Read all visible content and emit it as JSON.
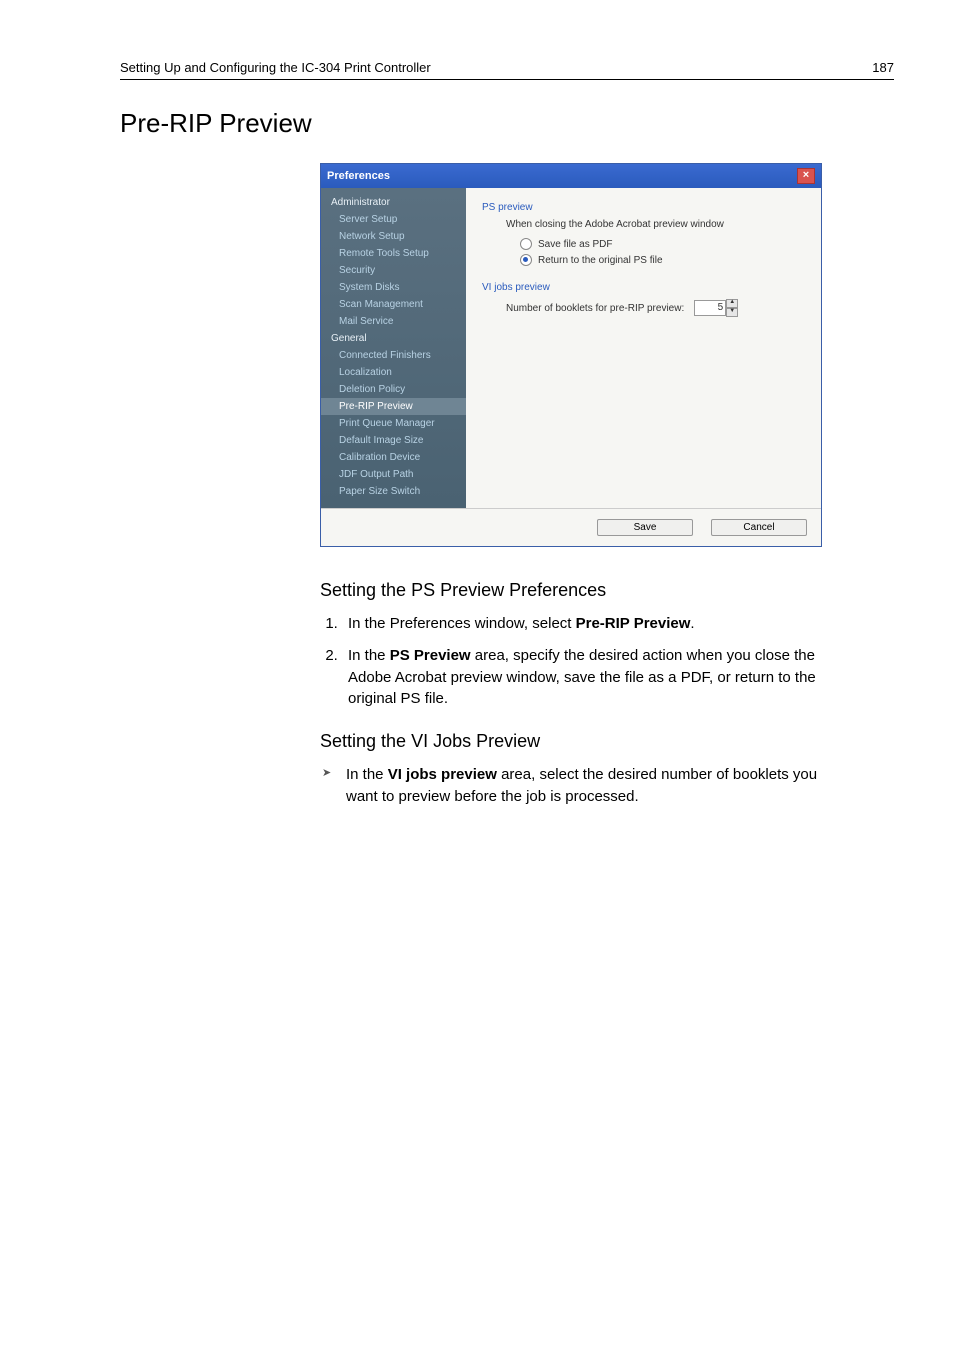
{
  "header": {
    "running_head": "Setting Up and Configuring the IC-304 Print Controller",
    "page_number": "187"
  },
  "section_title": "Pre-RIP Preview",
  "prefs": {
    "window_title": "Preferences",
    "sidebar": {
      "cat_admin": "Administrator",
      "items_admin": [
        "Server Setup",
        "Network Setup",
        "Remote Tools Setup",
        "Security",
        "System Disks",
        "Scan Management",
        "Mail Service"
      ],
      "cat_general": "General",
      "items_general": [
        "Connected Finishers",
        "Localization",
        "Deletion Policy",
        "Pre-RIP Preview",
        "Print Queue Manager",
        "Default Image Size",
        "Calibration Device",
        "JDF Output Path",
        "Paper Size Switch"
      ],
      "selected": "Pre-RIP Preview"
    },
    "content": {
      "ps_preview_title": "PS preview",
      "ps_preview_desc": "When closing the Adobe Acrobat preview window",
      "opt_save_pdf": "Save file as PDF",
      "opt_return_ps": "Return to the original PS file",
      "vi_title": "VI jobs preview",
      "vi_label": "Number of booklets for pre-RIP preview:",
      "vi_value": "5"
    },
    "buttons": {
      "save": "Save",
      "cancel": "Cancel"
    }
  },
  "body": {
    "h2_ps": "Setting the PS Preview Preferences",
    "step1_a": "In the Preferences window, select ",
    "step1_b": "Pre-RIP Preview",
    "step1_c": ".",
    "step2_a": "In the ",
    "step2_b": "PS Preview",
    "step2_c": " area, specify the desired action when you close the Adobe Acrobat preview window, save the file as a PDF, or return to the original PS file.",
    "h2_vi": "Setting the VI Jobs Preview",
    "vi_a": "In the ",
    "vi_b": "VI jobs preview",
    "vi_c": " area, select the desired number of booklets you want to preview before the job is processed."
  }
}
